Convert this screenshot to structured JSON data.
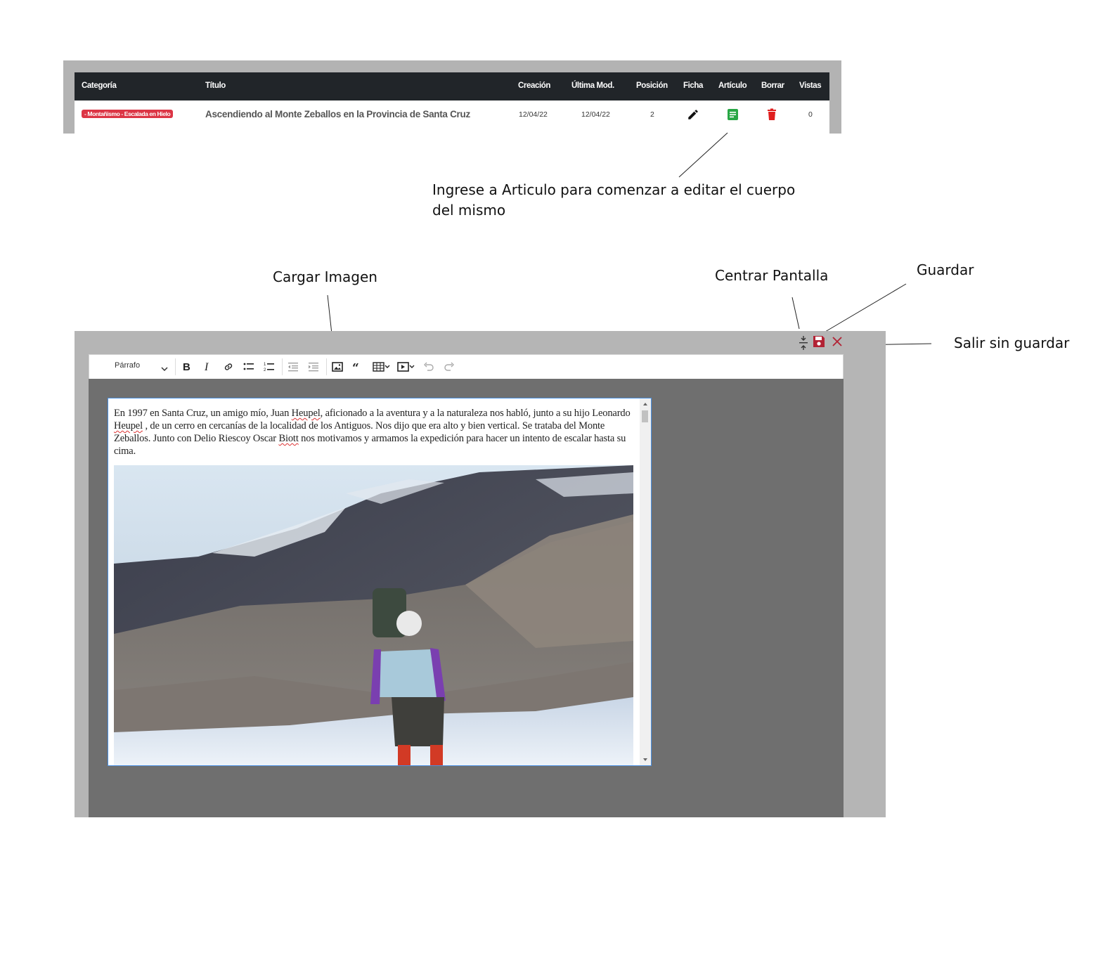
{
  "table": {
    "headers": {
      "categoria": "Categoría",
      "titulo": "Título",
      "creacion": "Creación",
      "ultima_mod": "Última Mod.",
      "posicion": "Posición",
      "ficha": "Ficha",
      "articulo": "Artículo",
      "borrar": "Borrar",
      "vistas": "Vistas"
    },
    "row": {
      "categoria": "- Montañismo - Escalada en Hielo",
      "titulo": "Ascendiendo al Monte Zeballos en la Provincia de Santa Cruz",
      "creacion": "12/04/22",
      "ultima_mod": "12/04/22",
      "posicion": "2",
      "vistas": "0",
      "ficha_icon": "pencil-icon",
      "articulo_icon": "article-icon",
      "borrar_icon": "trash-icon"
    }
  },
  "annotations": {
    "articulo_line1": "Ingrese a Articulo para comenzar a editar el cuerpo",
    "articulo_line2": "del mismo",
    "cargar_imagen": "Cargar Imagen",
    "centrar_pantalla": "Centrar Pantalla",
    "guardar": "Guardar",
    "salir_sin_guardar": "Salir sin guardar"
  },
  "editor": {
    "paragraph_format": "Párrafo",
    "toolbar_icons": [
      "bold-icon",
      "italic-icon",
      "link-icon",
      "bulleted-list-icon",
      "numbered-list-icon",
      "outdent-icon",
      "indent-icon",
      "image-icon",
      "blockquote-icon",
      "table-icon",
      "media-icon",
      "undo-icon",
      "redo-icon"
    ],
    "top_icons": [
      "center-screen-icon",
      "save-icon",
      "close-icon"
    ],
    "body": {
      "s1": "En 1997 en Santa Cruz, un amigo mío, Juan ",
      "w1": "Heupel",
      "s2": ", aficionado a la aventura y a la naturaleza nos habló, junto a su hijo Leonardo ",
      "w2": "Heupel",
      "s3": " , de un cerro en cercanías de la localidad de los Antiguos. Nos dijo que era alto y bien vertical. Se trataba del Monte Zeballos. Junto con Delio ",
      "w3": "Riesco",
      "s4": "y Oscar ",
      "w4": "Biott",
      "s5": " nos motivamos y armamos la expedición para hacer un intento de escalar hasta su cima."
    }
  },
  "colors": {
    "header_bg": "#212529",
    "badge": "#dc3545",
    "article_green": "#28a745",
    "trash_red": "#e01e1e",
    "save_red": "#b22234",
    "editor_border": "#4a90e2"
  }
}
